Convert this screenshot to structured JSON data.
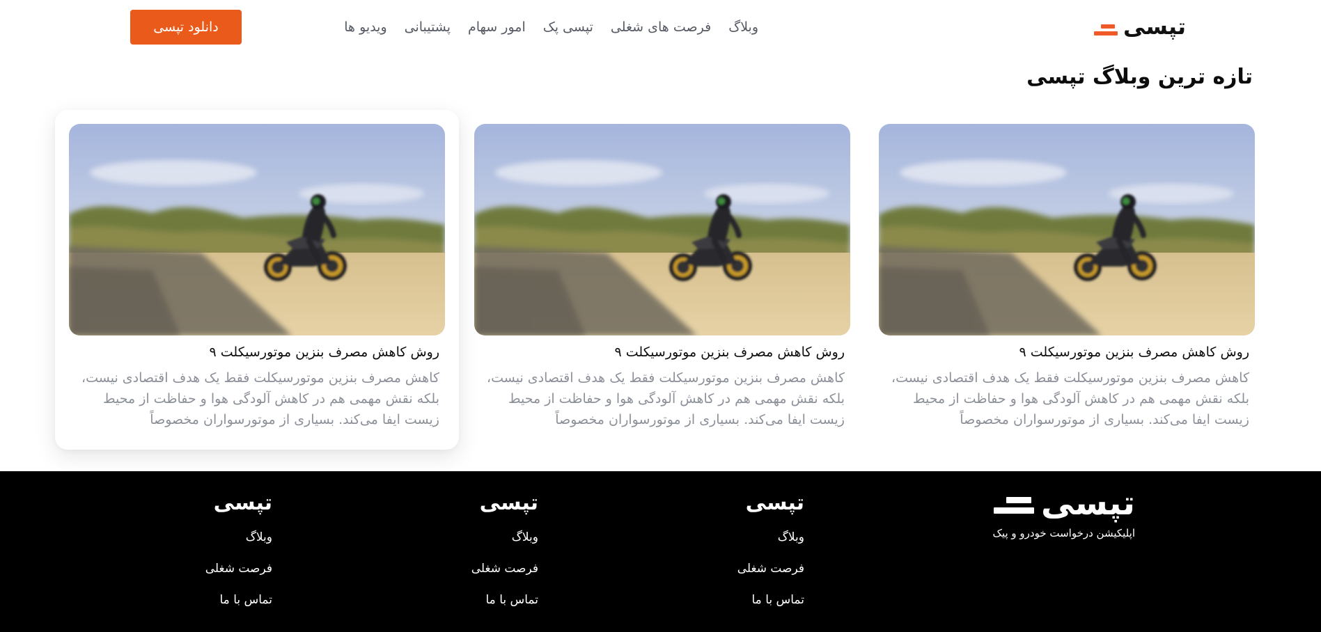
{
  "header": {
    "brand": "تپسی",
    "nav": [
      "وبلاگ",
      "فرصت های شغلی",
      "تپسی پک",
      "امور سهام",
      "پشتیبانی",
      "ویدیو ها"
    ],
    "download_label": "دانلود تپسی"
  },
  "section": {
    "title": "تازه ترین وبلاگ تپسی"
  },
  "cards": [
    {
      "title": "روش کاهش مصرف بنزین موتورسیکلت ۹",
      "excerpt": "کاهش مصرف بنزین موتورسیکلت فقط یک هدف اقتصادی نیست، بلکه نقش مهمی هم در کاهش آلودگی هوا و حفاظت از محیط زیست ایفا می‌کند. بسیاری از موتورسواران مخصوصاً"
    },
    {
      "title": "روش کاهش مصرف بنزین موتورسیکلت ۹",
      "excerpt": "کاهش مصرف بنزین موتورسیکلت فقط یک هدف اقتصادی نیست، بلکه نقش مهمی هم در کاهش آلودگی هوا و حفاظت از محیط زیست ایفا می‌کند. بسیاری از موتورسواران مخصوصاً"
    },
    {
      "title": "روش کاهش مصرف بنزین موتورسیکلت ۹",
      "excerpt": "کاهش مصرف بنزین موتورسیکلت فقط یک هدف اقتصادی نیست، بلکه نقش مهمی هم در کاهش آلودگی هوا و حفاظت از محیط زیست ایفا می‌کند. بسیاری از موتورسواران مخصوصاً"
    }
  ],
  "footer": {
    "brand": "تپسی",
    "tagline": "اپلیکیشن درخواست خودرو و پیک",
    "columns": [
      {
        "title": "تپسی",
        "links": [
          "وبلاگ",
          "فرصت شغلی",
          "تماس با ما"
        ]
      },
      {
        "title": "تپسی",
        "links": [
          "وبلاگ",
          "فرصت شغلی",
          "تماس با ما"
        ]
      },
      {
        "title": "تپسی",
        "links": [
          "وبلاگ",
          "فرصت شغلی",
          "تماس با ما"
        ]
      }
    ]
  },
  "colors": {
    "accent": "#ea5a1a",
    "footer_bg": "#000000",
    "excerpt_text": "#8c9099",
    "nav_text": "#555a63"
  },
  "icons": {
    "brand_mark": "tapsi-logo-mark",
    "card_image": "motorcycle-rider-photo"
  }
}
